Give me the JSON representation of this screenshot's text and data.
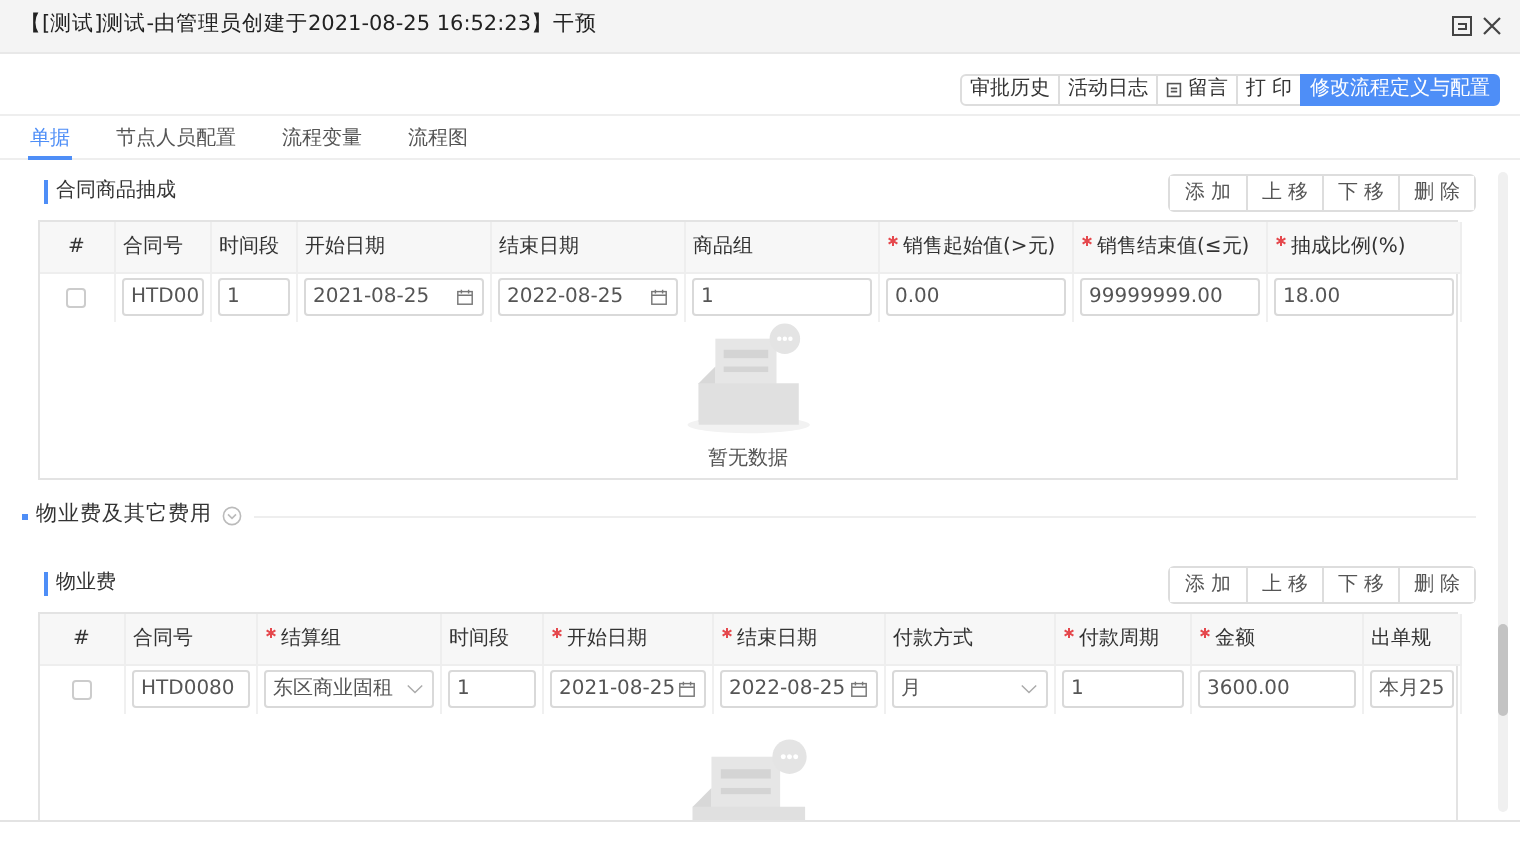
{
  "window": {
    "title": "【[测试]测试-由管理员创建于2021-08-25 16:52:23】干预"
  },
  "toolbar": [
    {
      "label": "审批历史",
      "icon": false,
      "primary": false
    },
    {
      "label": "活动日志",
      "icon": false,
      "primary": false
    },
    {
      "label": "留言",
      "icon": true,
      "primary": false
    },
    {
      "label": "打 印",
      "icon": false,
      "primary": false
    },
    {
      "label": "修改流程定义与配置",
      "icon": false,
      "primary": true
    }
  ],
  "tabs": [
    {
      "label": "单据",
      "selected": true
    },
    {
      "label": "节点人员配置",
      "selected": false
    },
    {
      "label": "流程变量",
      "selected": false
    },
    {
      "label": "流程图",
      "selected": false
    }
  ],
  "blocks": [
    {
      "kind": "subtable",
      "title": "合同商品抽成",
      "actions": [
        "添 加",
        "上 移",
        "下 移",
        "删 除"
      ],
      "columns": [
        {
          "label": "#",
          "required": false
        },
        {
          "label": "合同号",
          "required": false
        },
        {
          "label": "时间段",
          "required": false
        },
        {
          "label": "开始日期",
          "required": false
        },
        {
          "label": "结束日期",
          "required": false
        },
        {
          "label": "商品组",
          "required": false
        },
        {
          "label": "销售起始值(>元)",
          "required": true
        },
        {
          "label": "销售结束值(≤元)",
          "required": true
        },
        {
          "label": "抽成比例(%)",
          "required": true
        }
      ],
      "rows": [
        [
          {
            "kind": "checkbox",
            "checked": false
          },
          {
            "kind": "input",
            "value": "HTD00"
          },
          {
            "kind": "input",
            "value": "1"
          },
          {
            "kind": "date",
            "value": "2021-08-25"
          },
          {
            "kind": "date",
            "value": "2022-08-25"
          },
          {
            "kind": "input",
            "value": "1"
          },
          {
            "kind": "input",
            "value": "0.00"
          },
          {
            "kind": "input",
            "value": "99999999.00"
          },
          {
            "kind": "input",
            "value": "18.00"
          }
        ]
      ],
      "empty_text": "暂无数据"
    },
    {
      "kind": "section",
      "title": "物业费及其它费用"
    },
    {
      "kind": "subtable",
      "title": "物业费",
      "actions": [
        "添 加",
        "上 移",
        "下 移",
        "删 除"
      ],
      "columns": [
        {
          "label": "#",
          "required": false
        },
        {
          "label": "合同号",
          "required": false
        },
        {
          "label": "结算组",
          "required": true
        },
        {
          "label": "时间段",
          "required": false
        },
        {
          "label": "开始日期",
          "required": true
        },
        {
          "label": "结束日期",
          "required": true
        },
        {
          "label": "付款方式",
          "required": false
        },
        {
          "label": "付款周期",
          "required": true
        },
        {
          "label": "金额",
          "required": true
        },
        {
          "label": "出单规",
          "required": false
        }
      ],
      "rows": [
        [
          {
            "kind": "checkbox",
            "checked": false
          },
          {
            "kind": "input",
            "value": "HTD0080"
          },
          {
            "kind": "select",
            "value": "东区商业固租"
          },
          {
            "kind": "input",
            "value": "1"
          },
          {
            "kind": "date",
            "value": "2021-08-25"
          },
          {
            "kind": "date",
            "value": "2022-08-25"
          },
          {
            "kind": "select",
            "value": "月"
          },
          {
            "kind": "input",
            "value": "1"
          },
          {
            "kind": "input",
            "value": "3600.00"
          },
          {
            "kind": "input",
            "value": "本月25"
          }
        ]
      ]
    }
  ]
}
